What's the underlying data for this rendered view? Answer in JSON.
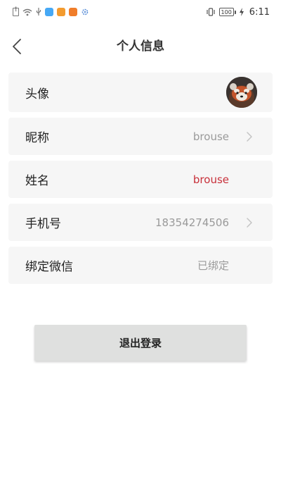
{
  "status_bar": {
    "time": "6:11",
    "battery_level": "100",
    "icons": [
      "sim-alert-icon",
      "wifi-icon",
      "usb-icon",
      "app-notification-icon",
      "app-notification-icon",
      "app-notification-icon",
      "gear-icon",
      "vibrate-icon",
      "battery-icon",
      "charging-icon"
    ]
  },
  "header": {
    "title": "个人信息",
    "back_icon": "chevron-left-icon"
  },
  "profile": {
    "avatar_label": "头像",
    "nickname_label": "昵称",
    "nickname_value": "brouse",
    "name_label": "姓名",
    "name_value": "brouse",
    "phone_label": "手机号",
    "phone_value": "18354274506",
    "wechat_label": "绑定微信",
    "wechat_value": "已绑定"
  },
  "actions": {
    "logout_label": "退出登录"
  },
  "colors": {
    "row_bg": "#f6f6f6",
    "accent_red": "#c8303a",
    "muted_text": "#9a9a9a",
    "button_bg": "#dfe0df"
  }
}
